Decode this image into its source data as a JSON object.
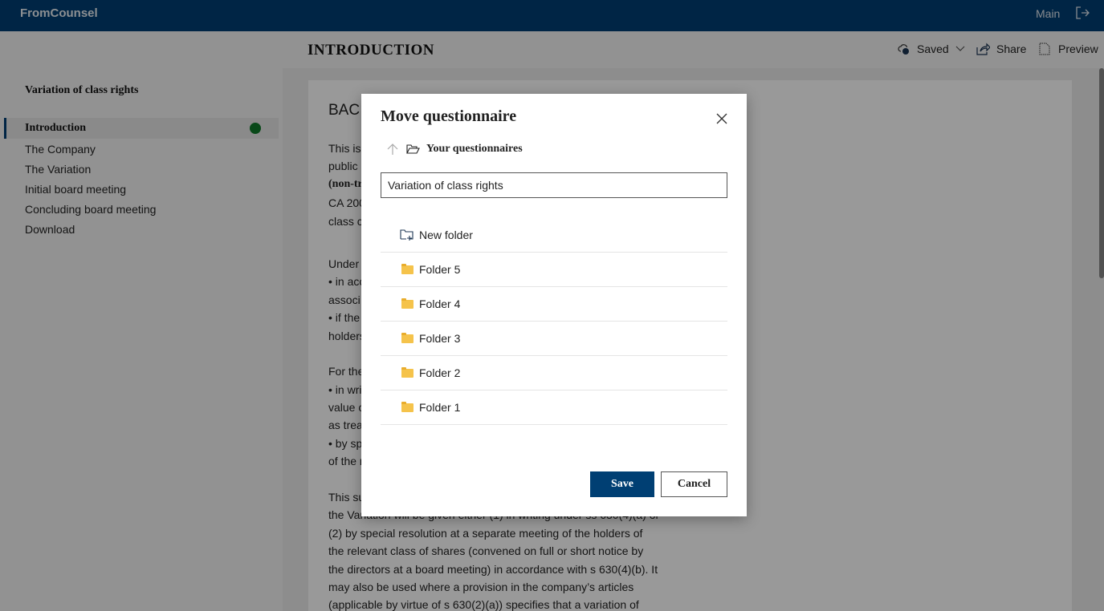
{
  "app": {
    "name": "FromCounsel",
    "main_link": "Main"
  },
  "header": {
    "title": "INTRODUCTION",
    "saved": "Saved",
    "share": "Share",
    "preview": "Preview"
  },
  "sidebar": {
    "title": "Variation of class rights",
    "items": [
      {
        "label": "Introduction",
        "active": true,
        "completed": true
      },
      {
        "label": "The Company"
      },
      {
        "label": "The Variation"
      },
      {
        "label": "Initial board meeting"
      },
      {
        "label": "Concluding board meeting"
      },
      {
        "label": "Download"
      }
    ]
  },
  "document": {
    "heading": "BAC",
    "lines": [
      "This is",
      "public",
      "(non-tr",
      "CA 200",
      "class c",
      "Under",
      "• in acc",
      "associ",
      "• if the",
      "holders",
      "For the",
      "• in wri",
      "value c",
      "as trea",
      "• by sp",
      "of the r",
      "This su",
      "the Variation will be given either (1) in writing under ss 630(4)(a) or",
      "(2) by special resolution at a separate meeting of the holders of",
      "the relevant class of shares (convened on full or short notice by",
      "the directors at a board meeting) in accordance with s 630(4)(b). It",
      "may also be used where a provision in the company’s articles",
      "(applicable by virtue of s 630(2)(a)) specifies that a variation of"
    ]
  },
  "modal": {
    "title": "Move questionnaire",
    "breadcrumb": "Your questionnaires",
    "name_value": "Variation of class rights",
    "new_folder": "New folder",
    "folders": [
      "Folder 5",
      "Folder 4",
      "Folder 3",
      "Folder 2",
      "Folder 1"
    ],
    "save": "Save",
    "cancel": "Cancel"
  },
  "colors": {
    "brand": "#003f73",
    "folder": "#f5c34b",
    "success": "#0f7a2b"
  }
}
